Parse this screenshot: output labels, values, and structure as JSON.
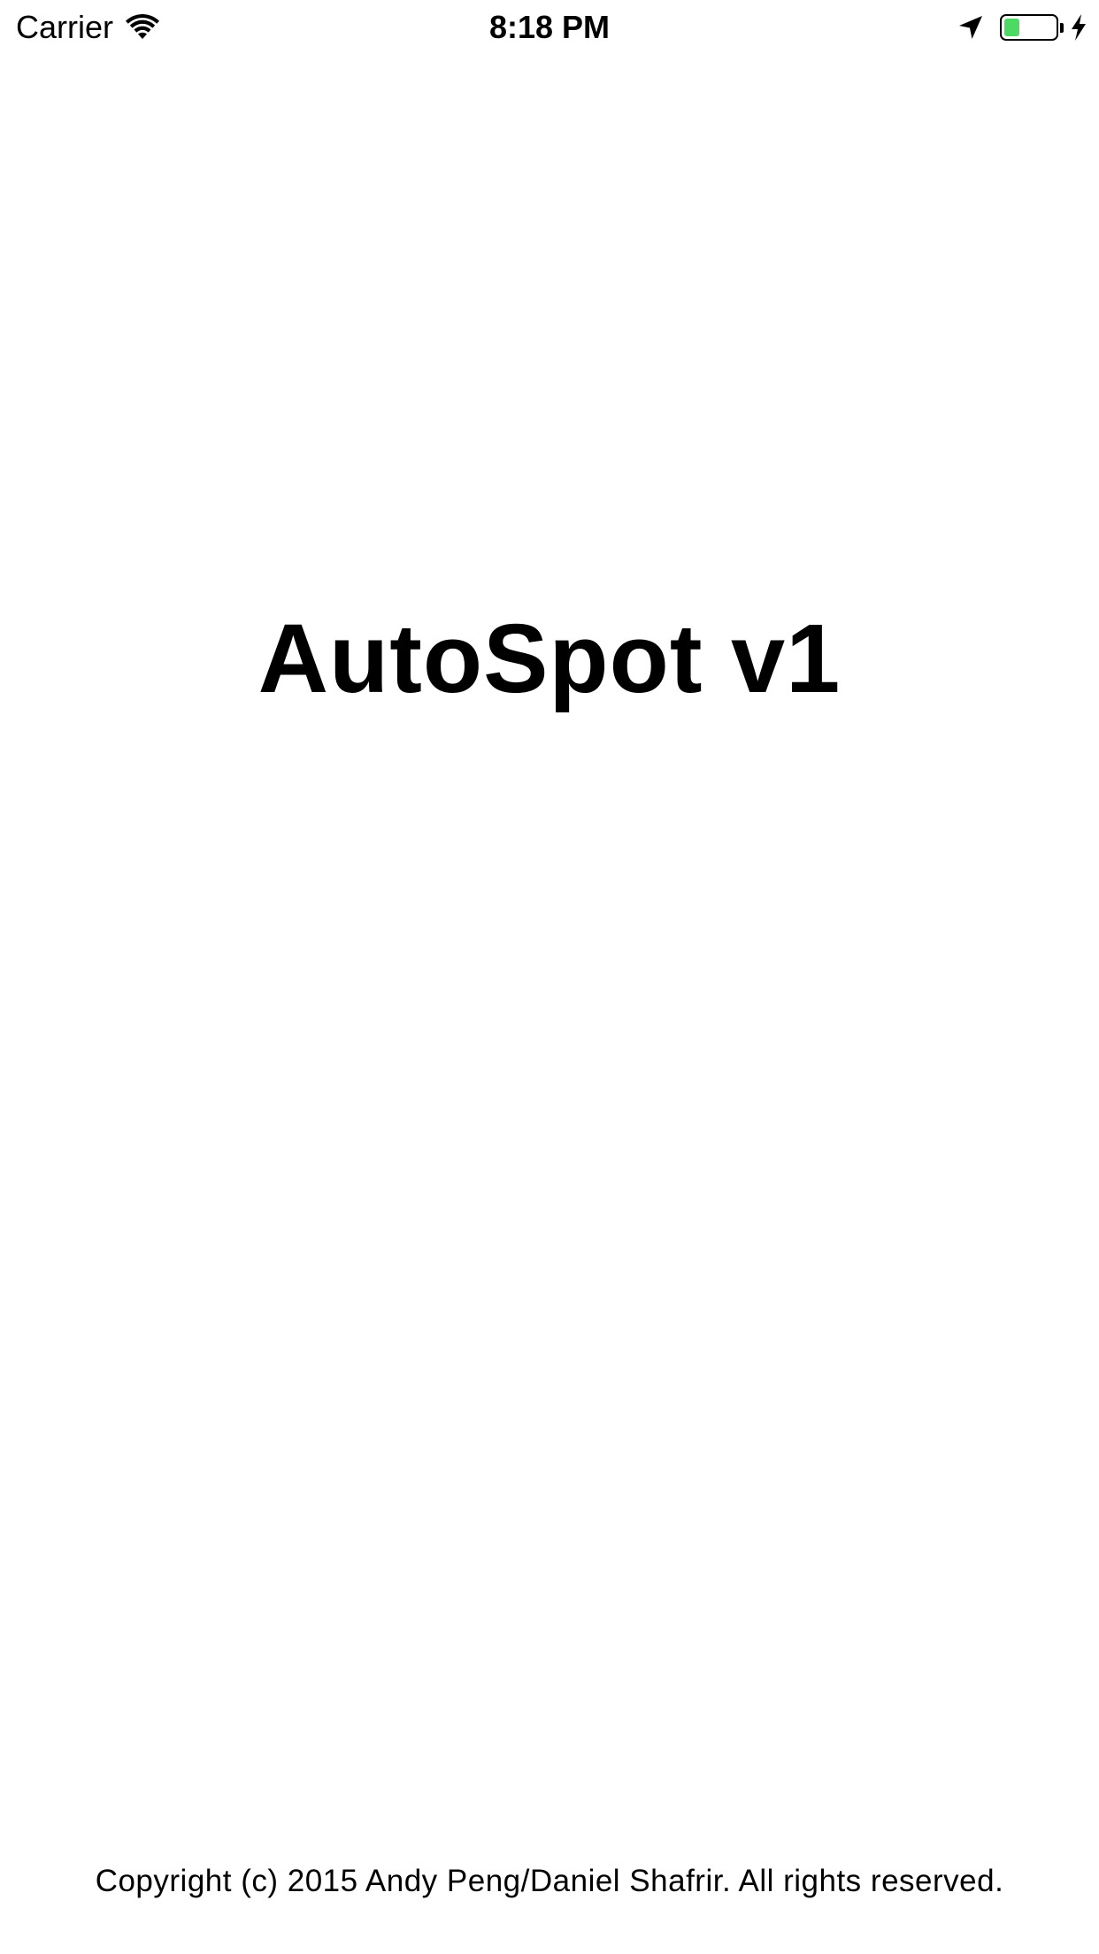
{
  "status_bar": {
    "carrier": "Carrier",
    "time": "8:18 PM",
    "icons": [
      "wifi-icon",
      "location-arrow-icon",
      "battery-icon",
      "charging-bolt-icon"
    ],
    "battery_level": 0.3,
    "battery_color": "#4cd964"
  },
  "app": {
    "title": "AutoSpot v1",
    "copyright": "Copyright (c) 2015 Andy Peng/Daniel Shafrir. All rights reserved."
  }
}
